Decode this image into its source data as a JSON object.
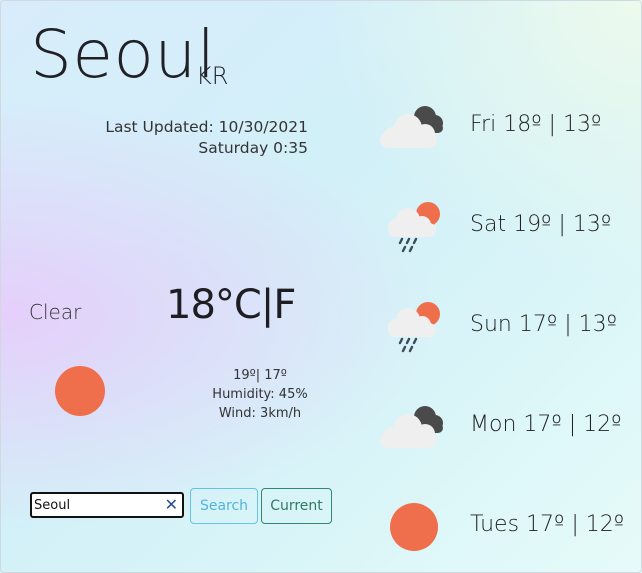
{
  "location": {
    "city": "Seoul",
    "country": "KR"
  },
  "updated": {
    "line1": "Last Updated: 10/30/2021",
    "line2": "Saturday 0:35"
  },
  "current": {
    "description": "Clear",
    "temperature": "18°",
    "unit_c": "C",
    "separator": "|",
    "unit_f": "F",
    "icon": "clear-sun-icon",
    "hi_lo": "19º| 17º",
    "humidity": "Humidity: 45%",
    "wind": "Wind: 3km/h"
  },
  "search": {
    "value": "Seoul",
    "clear_symbol": "✕",
    "search_label": "Search",
    "current_label": "Current"
  },
  "forecast": [
    {
      "text": "Fri 18º | 13º",
      "icon": "broken-clouds-icon"
    },
    {
      "text": "Sat 19º | 13º",
      "icon": "rain-sun-icon"
    },
    {
      "text": "Sun 17º | 13º",
      "icon": "rain-sun-icon"
    },
    {
      "text": "Mon 17º | 12º",
      "icon": "broken-clouds-icon"
    },
    {
      "text": "Tues 17º | 12º",
      "icon": "clear-sun-icon"
    }
  ],
  "colors": {
    "sun": "#ef6f4c",
    "cloud_light": "#eeeeee",
    "cloud_dark": "#4a4a4a",
    "search_button": "#53b3db",
    "current_button": "#2e7b62"
  }
}
